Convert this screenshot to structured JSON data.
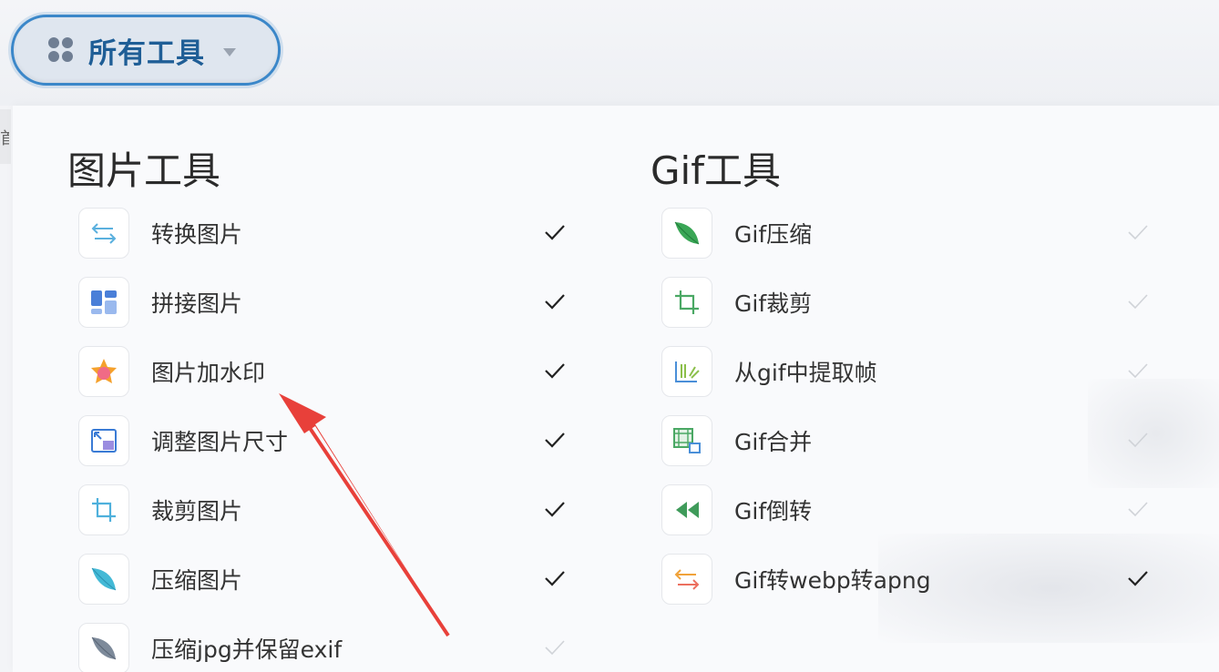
{
  "dropdown": {
    "label": "所有工具",
    "icon": "grid-dots-icon",
    "caret_icon": "caret-down-icon"
  },
  "left_edge_text": "首",
  "image_tools": {
    "title": "图片工具",
    "items": [
      {
        "label": "转换图片",
        "icon": "swap-arrows-icon",
        "checked": true
      },
      {
        "label": "拼接图片",
        "icon": "collage-icon",
        "checked": true
      },
      {
        "label": "图片加水印",
        "icon": "star-badge-icon",
        "checked": true
      },
      {
        "label": "调整图片尺寸",
        "icon": "resize-icon",
        "checked": true
      },
      {
        "label": "裁剪图片",
        "icon": "crop-icon",
        "checked": true
      },
      {
        "label": "压缩图片",
        "icon": "leaf-icon",
        "checked": true
      },
      {
        "label": "压缩jpg并保留exif",
        "icon": "leaf-gray-icon",
        "checked": false
      }
    ]
  },
  "gif_tools": {
    "title": "Gif工具",
    "items": [
      {
        "label": "Gif压缩",
        "icon": "leaf-green-icon",
        "checked": false
      },
      {
        "label": "Gif裁剪",
        "icon": "crop-green-icon",
        "checked": false
      },
      {
        "label": "从gif中提取帧",
        "icon": "extract-frames-icon",
        "checked": false
      },
      {
        "label": "Gif合并",
        "icon": "merge-frames-icon",
        "checked": false
      },
      {
        "label": "Gif倒转",
        "icon": "rewind-icon",
        "checked": false
      },
      {
        "label": "Gif转webp转apng",
        "icon": "swap-arrows-orange-icon",
        "checked": true
      }
    ]
  },
  "colors": {
    "accent": "#3b87c9",
    "arrow": "#e8403a",
    "check_active": "#222222",
    "check_inactive": "#c9ccd2"
  }
}
